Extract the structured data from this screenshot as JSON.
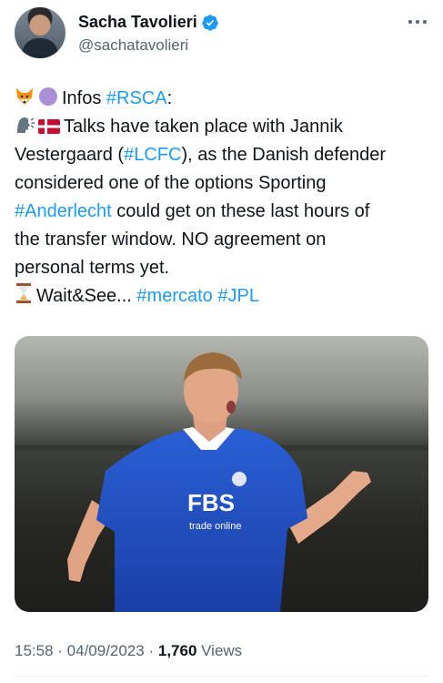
{
  "author": {
    "name": "Sacha Tavolieri",
    "handle": "@sachatavolieri",
    "verified_color": "#1d9bf0"
  },
  "tweet": {
    "line1_emojis": [
      "fox-emoji",
      "purple-circle-emoji"
    ],
    "line1_text": "Infos ",
    "line1_tag": "#RSCA",
    "line1_end": ":",
    "line2_emojis": [
      "speaking-head-emoji",
      "denmark-flag-emoji"
    ],
    "line2_text": "Talks have taken place with Jannik",
    "line3_pre": "Vestergaard (",
    "line3_tag": "#LCFC",
    "line3_post": "), as the Danish defender",
    "line4_text": "considered one of the options Sporting",
    "line5_tag": "#Anderlecht",
    "line5_post": " could get on these last hours of",
    "line6_text": "the transfer window. NO agreement on",
    "line7_text": "personal terms yet.",
    "line8_emoji": "hourglass-emoji",
    "line8_text": "Wait&See... ",
    "line8_tag1": "#mercato",
    "line8_space": " ",
    "line8_tag2": "#JPL"
  },
  "media": {
    "shirt_sponsor": "FBS",
    "shirt_sub": "trade online",
    "shirt_color": "#1f4fc1"
  },
  "meta": {
    "time": "15:58",
    "sep1": " · ",
    "date": "04/09/2023",
    "sep2": " · ",
    "views_count": "1,760",
    "views_label": " Views"
  },
  "colors": {
    "link": "#1d9bf0",
    "secondary_text": "#536471"
  }
}
